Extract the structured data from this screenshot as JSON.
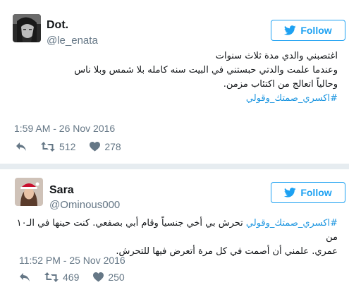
{
  "tweets": [
    {
      "name": "Dot.",
      "handle": "@le_enata",
      "follow_label": "Follow",
      "lines": [
        "اغتصبني والدي مدة ثلاث سنوات",
        "وعندما علمت والدتي حبستني في البيت سنه كامله بلا شمس وبلا ناس",
        "وحالياً اتعالج من اكتئاب مزمن."
      ],
      "hashtag": "#اكسري_صمتك_وقولي",
      "timestamp": "1:59 AM - 26 Nov 2016",
      "retweets": "512",
      "likes": "278"
    },
    {
      "name": "Sara",
      "handle": "@Ominous000",
      "follow_label": "Follow",
      "hashtag": "#اكسري_صمتك_وقولي",
      "line1_rest": " تحرش بي أخي جنسياً وقام أبي بصفعي. كنت حينها في الـ١٠ من",
      "line2": "عمري. علمني أن أصمت في كل مرة أتعرض فيها للتحرش.",
      "timestamp": "11:52 PM - 25 Nov 2016",
      "retweets": "469",
      "likes": "250"
    }
  ],
  "icons": {
    "reply": "reply-icon",
    "retweet": "retweet-icon",
    "like": "heart-icon",
    "bird": "twitter-bird-icon"
  },
  "colors": {
    "accent": "#1da1f2",
    "hashtag": "#1b95e0",
    "muted": "#657786",
    "divider": "#e6ecf0"
  }
}
